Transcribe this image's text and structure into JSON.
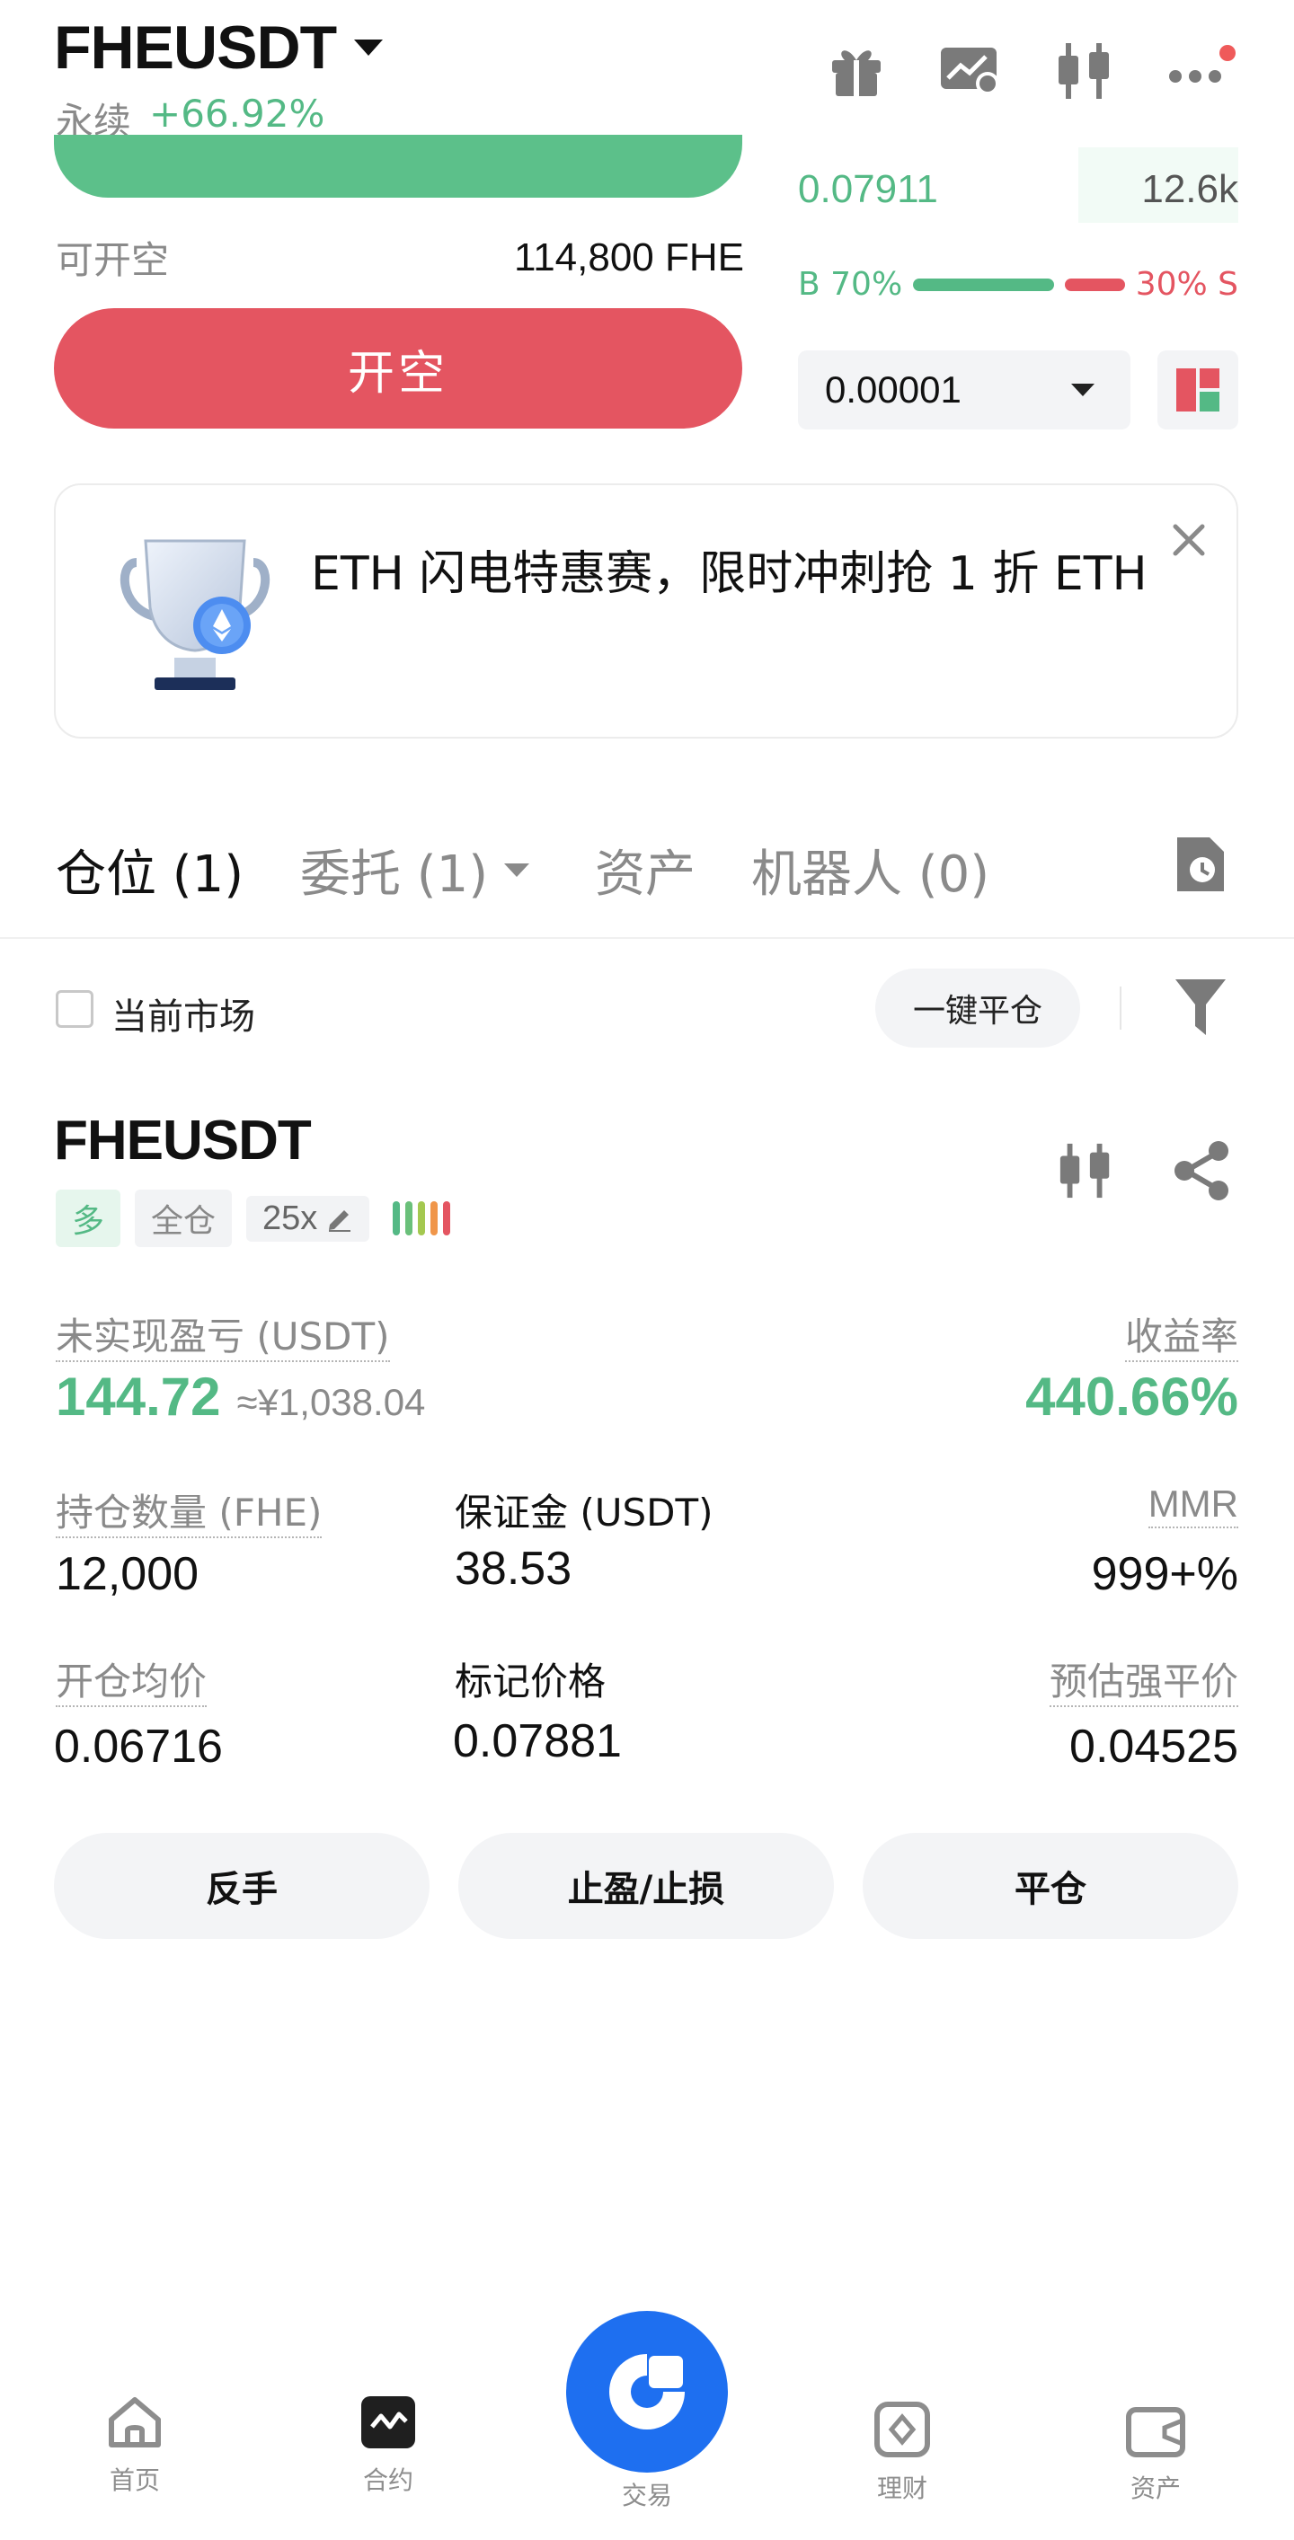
{
  "header": {
    "symbol": "FHEUSDT",
    "type": "永续",
    "change": "+66.92%"
  },
  "order_panel": {
    "short_available_label": "可开空",
    "short_available_value": "114,800 FHE",
    "open_short_label": "开空",
    "last_price": "0.07911",
    "last_qty": "12.6k",
    "buy_ratio_label": "B 70%",
    "sell_ratio_label": "30% S",
    "buy_ratio": 0.7,
    "tick_size": "0.00001"
  },
  "banner": {
    "text": "ETH 闪电特惠赛，限时冲刺抢 1 折 ETH"
  },
  "tabs": [
    {
      "label": "仓位 (1)",
      "active": true
    },
    {
      "label": "委托 (1)",
      "active": false
    },
    {
      "label": "资产",
      "active": false
    },
    {
      "label": "机器人 (0)",
      "active": false
    }
  ],
  "filter": {
    "current_market_label": "当前市场",
    "close_all_label": "一键平仓"
  },
  "position": {
    "symbol": "FHEUSDT",
    "side": "多",
    "margin_mode": "全仓",
    "leverage": "25x",
    "unrealized_pnl_label": "未实现盈亏 (USDT)",
    "unrealized_pnl": "144.72",
    "unrealized_pnl_cny": "≈¥1,038.04",
    "roe_label": "收益率",
    "roe": "440.66%",
    "size_label": "持仓数量 (FHE)",
    "size": "12,000",
    "margin_label": "保证金 (USDT)",
    "margin": "38.53",
    "mmr_label": "MMR",
    "mmr": "999+%",
    "entry_label": "开仓均价",
    "entry": "0.06716",
    "mark_label": "标记价格",
    "mark": "0.07881",
    "liq_label": "预估强平价",
    "liq": "0.04525",
    "btn_reverse": "反手",
    "btn_tpsl": "止盈/止损",
    "btn_close": "平仓"
  },
  "bottom_nav": [
    {
      "label": "首页",
      "icon": "home-icon"
    },
    {
      "label": "合约",
      "icon": "contract-icon"
    },
    {
      "label": "交易",
      "icon": "trade-icon"
    },
    {
      "label": "理财",
      "icon": "earn-icon"
    },
    {
      "label": "资产",
      "icon": "wallet-icon"
    }
  ],
  "colors": {
    "green": "#54b985",
    "red": "#e45561",
    "orange": "#f0964a",
    "brand_blue": "#1e6ff0"
  }
}
